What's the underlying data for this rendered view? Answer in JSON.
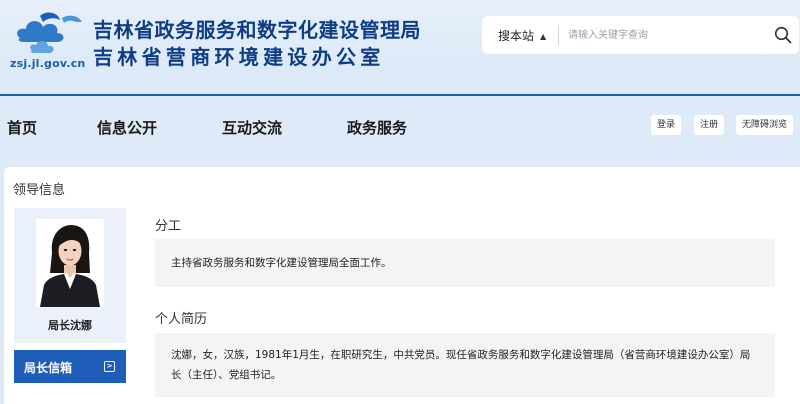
{
  "header": {
    "logo_text": "zsj.jl.gov.cn",
    "title_line1": "吉林省政务服务和数字化建设管理局",
    "title_line2": "吉林省营商环境建设办公室"
  },
  "search": {
    "site_label": "搜本站",
    "placeholder": "请输入关键字查询",
    "value": ""
  },
  "nav": {
    "items": [
      "首页",
      "信息公开",
      "互动交流",
      "政务服务"
    ],
    "utility": [
      "登录",
      "注册",
      "无障碍浏览"
    ]
  },
  "leader": {
    "section_title": "领导信息",
    "name_title": "局长沈娜",
    "mailbox_label": "局长信箱",
    "duty_heading": "分工",
    "duty_text": "主持省政务服务和数字化建设管理局全面工作。",
    "bio_heading": "个人简历",
    "bio_text": "沈娜，女，汉族，1981年1月生，在职研究生，中共党员。现任省政务服务和数字化建设管理局（省营商环境建设办公室）局长（主任）、党组书记。"
  },
  "colors": {
    "page_bg": "#dfeaf8",
    "title_blue": "#0e3d85",
    "accent_blue": "#1f5eb8",
    "panel_bg": "#eaf1fa",
    "box_bg": "#f3f4f6"
  },
  "icons": {
    "logo": "logo-icon",
    "search": "search-icon",
    "select_arrows": "updown-arrows-icon",
    "mailbox_arrow": "chevron-right-icon"
  }
}
